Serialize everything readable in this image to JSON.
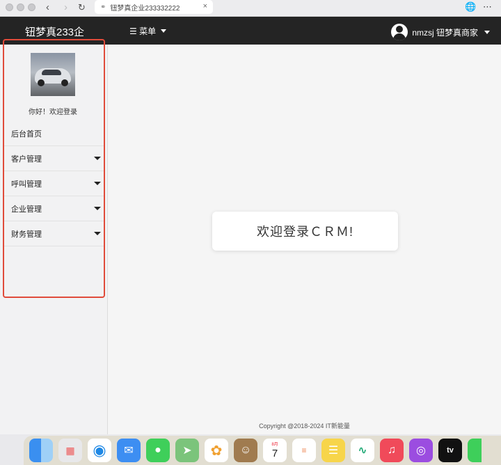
{
  "browser": {
    "tab_title": "钮梦真企业233332222",
    "close": "×",
    "icons": [
      "back-icon",
      "forward-icon",
      "reload-icon",
      "link-icon",
      "globe-icon",
      "more-icon"
    ]
  },
  "header": {
    "brand": "钮梦真233企",
    "menu_label": "☰ 菜单",
    "user_name": "nmzsj 钮梦真商家"
  },
  "sidebar": {
    "welcome": "你好！欢迎登录",
    "items": [
      {
        "label": "后台首页",
        "has_submenu": false
      },
      {
        "label": "客户管理",
        "has_submenu": true
      },
      {
        "label": "呼叫管理",
        "has_submenu": true
      },
      {
        "label": "企业管理",
        "has_submenu": true
      },
      {
        "label": "财务管理",
        "has_submenu": true
      }
    ]
  },
  "main": {
    "welcome_card": "欢迎登录ＣＲＭ!",
    "footer": "Copyright @2018-2024 IT新能量"
  },
  "dock": {
    "calendar_month": "8月",
    "calendar_day": "7",
    "tv_label": "tv",
    "apps": [
      "finder-icon",
      "launchpad-icon",
      "safari-icon",
      "mail-icon",
      "messages-icon",
      "maps-icon",
      "photos-icon",
      "contacts-icon",
      "calendar-icon",
      "reminders-icon",
      "notes-icon",
      "freeform-icon",
      "music-icon",
      "podcasts-icon",
      "tv-icon",
      "facetime-icon"
    ]
  },
  "colors": {
    "header_bg": "#242424",
    "sidebar_outline": "#e04b3a",
    "sidebar_bg": "#f2f2f3",
    "main_bg": "#f5f5f5"
  }
}
